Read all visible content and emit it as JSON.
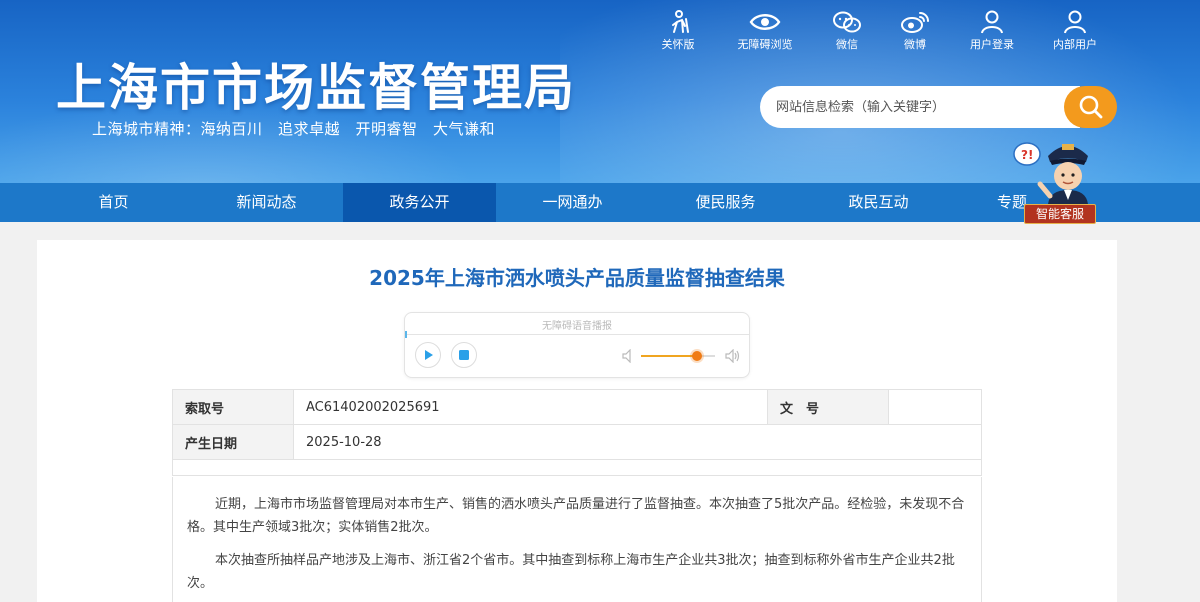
{
  "header": {
    "site_title": "上海市市场监督管理局",
    "slogan": "上海城市精神：海纳百川　追求卓越　开明睿智　大气谦和",
    "top_links": [
      {
        "label": "关怀版",
        "icon": "elderly-care-icon"
      },
      {
        "label": "无障碍浏览",
        "icon": "eye-icon"
      },
      {
        "label": "微信",
        "icon": "wechat-icon"
      },
      {
        "label": "微博",
        "icon": "weibo-icon"
      },
      {
        "label": "用户登录",
        "icon": "user-icon"
      },
      {
        "label": "内部用户",
        "icon": "internal-user-icon"
      }
    ],
    "search": {
      "placeholder": "网站信息检索（输入关键字）"
    }
  },
  "nav": {
    "items": [
      "首页",
      "新闻动态",
      "政务公开",
      "一网通办",
      "便民服务",
      "政民互动",
      "专题"
    ],
    "active_index": 2
  },
  "assistant": {
    "label": "智能客服"
  },
  "article": {
    "title": "2025年上海市洒水喷头产品质量监督抽查结果",
    "player": {
      "caption": "无障碍语音播报",
      "volume": 0.75
    },
    "meta": {
      "index_label": "索取号",
      "index_value": "AC61402002025691",
      "doc_label": "文　号",
      "doc_value": "",
      "date_label": "产生日期",
      "date_value": "2025-10-28"
    },
    "paragraphs": [
      "近期，上海市市场监督管理局对本市生产、销售的洒水喷头产品质量进行了监督抽查。本次抽查了5批次产品。经检验，未发现不合格。其中生产领域3批次；实体销售2批次。",
      "本次抽查所抽样品产地涉及上海市、浙江省2个省市。其中抽查到标称上海市生产企业共3批次；抽查到标称外省市生产企业共2批次。"
    ]
  },
  "colors": {
    "header": "#2b82dc",
    "nav": "#1d78c9",
    "nav_active": "#0a57ad",
    "search_button": "#f39a1d",
    "title": "#1f68ba"
  }
}
